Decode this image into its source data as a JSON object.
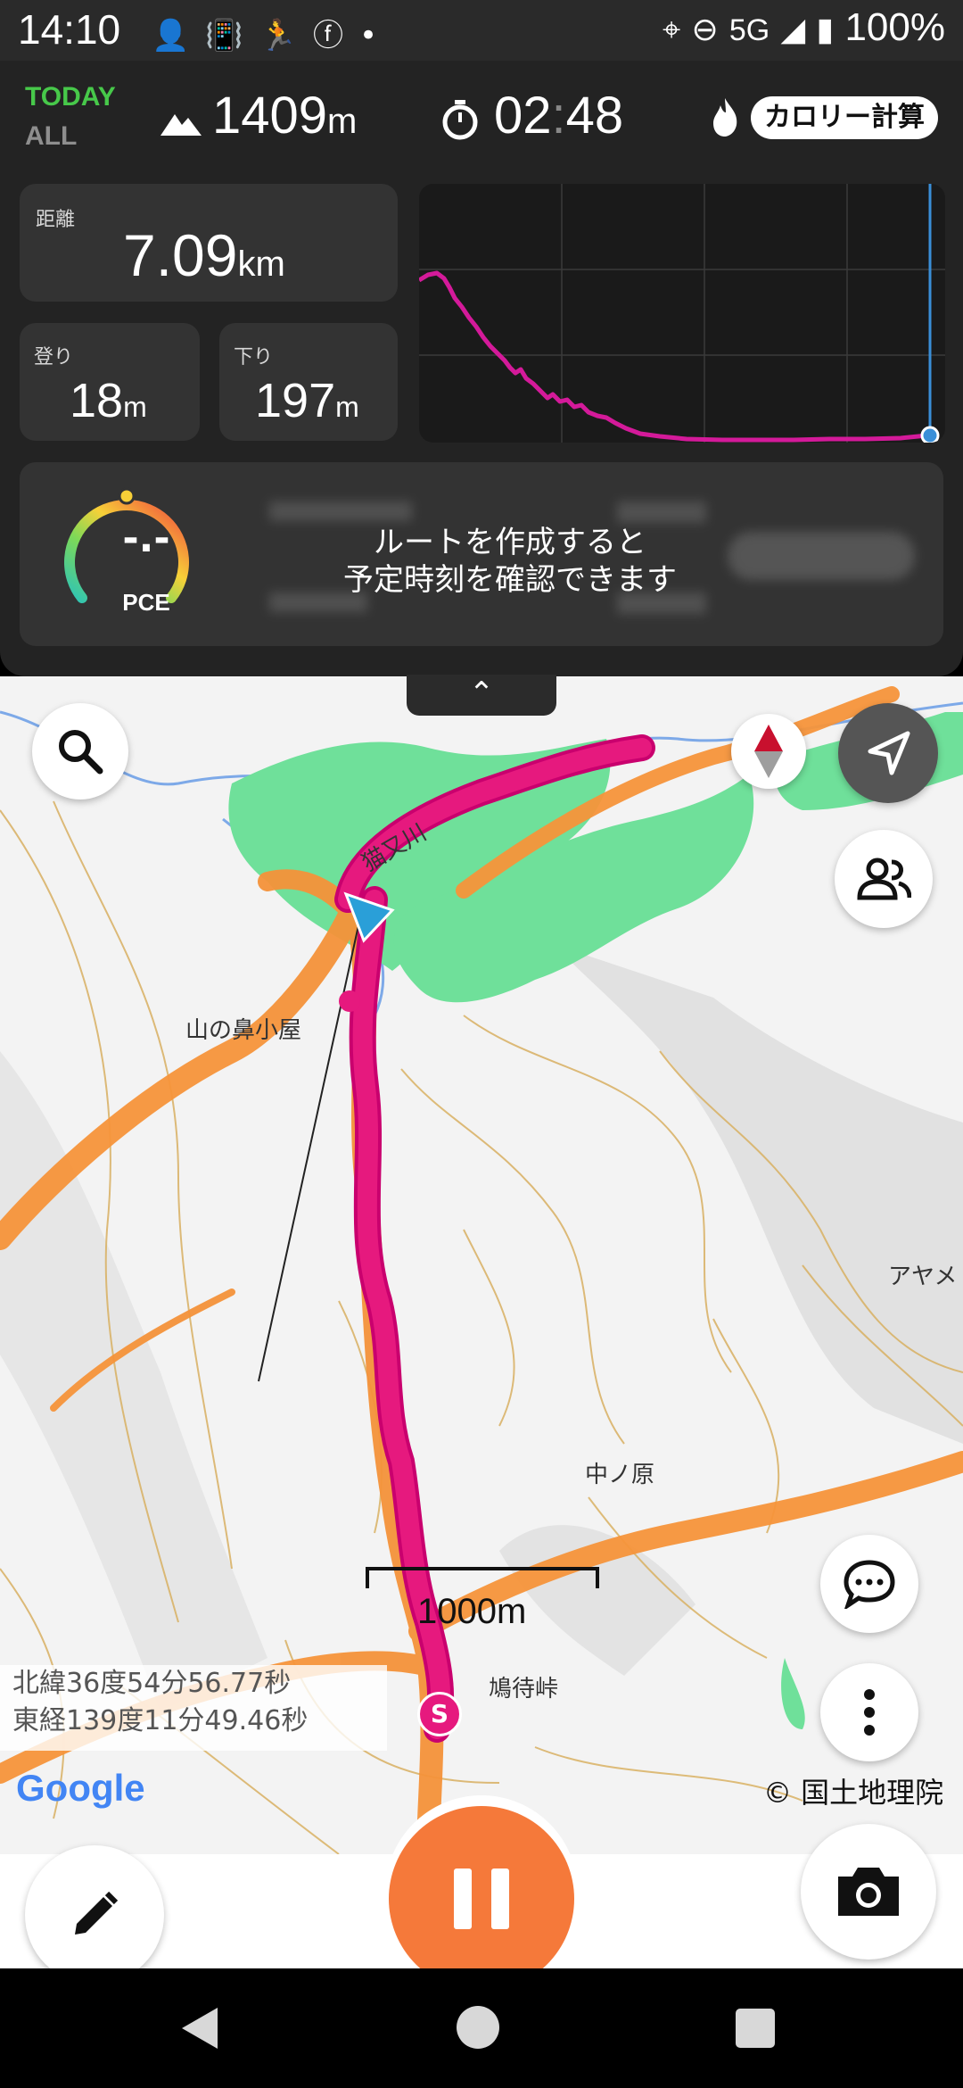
{
  "status_bar": {
    "time": "14:10",
    "network": "5G",
    "battery": "100%",
    "icons_left": [
      "person-add-icon",
      "vibrate-icon",
      "run-icon",
      "facebook-icon",
      "dot-icon"
    ],
    "icons_right": [
      "location-icon",
      "dnd-icon",
      "signal-icon",
      "battery-icon"
    ]
  },
  "header": {
    "today_label": "TODAY",
    "all_label": "ALL",
    "altitude_value": "1409",
    "altitude_unit": "m",
    "elapsed_time_h": "02",
    "elapsed_time_m": "48",
    "calorie_button": "カロリー計算"
  },
  "stats": {
    "distance_label": "距離",
    "distance_value": "7.09",
    "distance_unit": "km",
    "ascent_label": "登り",
    "ascent_value": "18",
    "ascent_unit": "m",
    "descent_label": "下り",
    "descent_value": "197",
    "descent_unit": "m"
  },
  "pace": {
    "gauge_value": "-.-",
    "gauge_label": "PCE",
    "message_line1": "ルートを作成すると",
    "message_line2": "予定時刻を確認できます"
  },
  "map": {
    "labels": {
      "river": "猫又川",
      "hut": "山の鼻小屋",
      "area1": "中ノ原",
      "pass": "鳩待峠",
      "right_edge": "アヤメ"
    },
    "scale_label": "1000m",
    "start_marker": "S",
    "coords_lat": "北緯36度54分56.77秒",
    "coords_lon": "東経139度11分49.46秒",
    "google_logo": "Google",
    "attribution": "© 国土地理院",
    "colors": {
      "track": "#e6197e",
      "trail": "#f5933a",
      "forest": "#6fe09a",
      "river": "#7da9e8",
      "contour": "#d8b062"
    }
  },
  "bottom_bar": {
    "colors": {
      "pause": "#f5793a"
    }
  }
}
